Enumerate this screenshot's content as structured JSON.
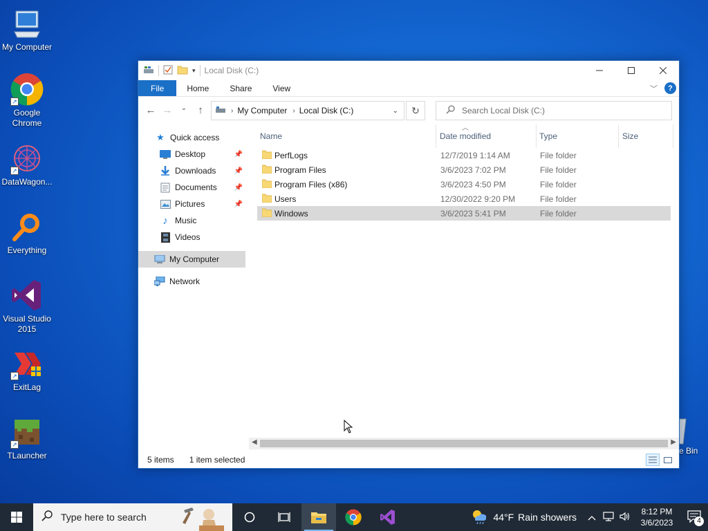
{
  "desktop": {
    "icons": [
      {
        "label": "My Computer",
        "icon": "computer-icon"
      },
      {
        "label": "Google Chrome",
        "icon": "chrome-icon"
      },
      {
        "label": "DataWagon...",
        "icon": "datawagon-icon"
      },
      {
        "label": "Everything",
        "icon": "everything-search-icon"
      },
      {
        "label": "Visual Studio 2015",
        "icon": "visual-studio-icon"
      },
      {
        "label": "ExitLag",
        "icon": "exitlag-icon"
      },
      {
        "label": "TLauncher",
        "icon": "tlauncher-icon"
      }
    ],
    "recycle_bin_partial": "e Bin"
  },
  "window": {
    "title": "Local Disk (C:)",
    "ribbon_tabs": [
      "File",
      "Home",
      "Share",
      "View"
    ],
    "address": {
      "crumbs": [
        "My Computer",
        "Local Disk (C:)"
      ]
    },
    "search_placeholder": "Search Local Disk (C:)",
    "columns": [
      "Name",
      "Date modified",
      "Type",
      "Size"
    ],
    "nav_pane": [
      {
        "label": "Quick access",
        "icon": "star-icon"
      },
      {
        "label": "Desktop",
        "icon": "desktop-folder-icon",
        "pinned": true
      },
      {
        "label": "Downloads",
        "icon": "downloads-icon",
        "pinned": true
      },
      {
        "label": "Documents",
        "icon": "documents-icon",
        "pinned": true
      },
      {
        "label": "Pictures",
        "icon": "pictures-icon",
        "pinned": true
      },
      {
        "label": "Music",
        "icon": "music-icon"
      },
      {
        "label": "Videos",
        "icon": "videos-icon"
      },
      {
        "label": "My Computer",
        "icon": "computer-icon",
        "selected": true
      },
      {
        "label": "Network",
        "icon": "network-icon"
      }
    ],
    "files": [
      {
        "name": "PerfLogs",
        "date": "12/7/2019 1:14 AM",
        "type": "File folder"
      },
      {
        "name": "Program Files",
        "date": "3/6/2023 7:02 PM",
        "type": "File folder"
      },
      {
        "name": "Program Files (x86)",
        "date": "3/6/2023 4:50 PM",
        "type": "File folder"
      },
      {
        "name": "Users",
        "date": "12/30/2022 9:20 PM",
        "type": "File folder"
      },
      {
        "name": "Windows",
        "date": "3/6/2023 5:41 PM",
        "type": "File folder",
        "selected": true
      }
    ],
    "status": {
      "items": "5 items",
      "selected": "1 item selected"
    }
  },
  "taskbar": {
    "search_placeholder": "Type here to search",
    "weather": {
      "temp": "44°F",
      "condition": "Rain showers"
    },
    "clock": {
      "time": "8:12 PM",
      "date": "3/6/2023"
    },
    "notification_count": "4"
  },
  "colors": {
    "accent": "#1a6fc7",
    "folder": "#f8d775",
    "selection": "#d9d9d9",
    "taskbar": "#202a36"
  }
}
